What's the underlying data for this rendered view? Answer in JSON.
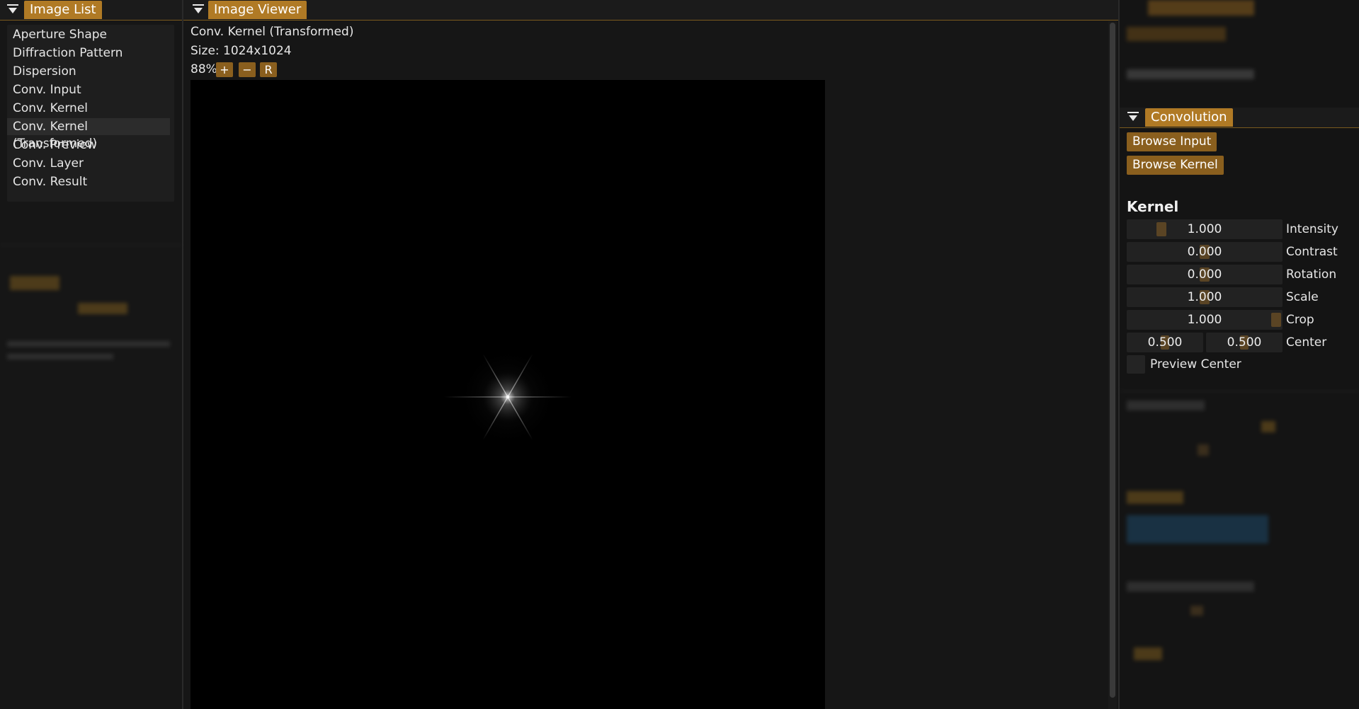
{
  "image_list": {
    "tab_label": "Image List",
    "items": [
      {
        "label": "Aperture Shape",
        "selected": false
      },
      {
        "label": "Diffraction Pattern",
        "selected": false
      },
      {
        "label": "Dispersion",
        "selected": false
      },
      {
        "label": "Conv. Input",
        "selected": false
      },
      {
        "label": "Conv. Kernel",
        "selected": false
      },
      {
        "label": "Conv. Kernel (Transformed)",
        "selected": true
      },
      {
        "label": "Conv. Preview",
        "selected": false
      },
      {
        "label": "Conv. Layer",
        "selected": false
      },
      {
        "label": "Conv. Result",
        "selected": false
      }
    ]
  },
  "image_viewer": {
    "tab_label": "Image Viewer",
    "image_name": "Conv. Kernel (Transformed)",
    "size_text": "Size: 1024x1024",
    "zoom_level": "88%",
    "zoom_in_label": "+",
    "zoom_out_label": "−",
    "reset_label": "R"
  },
  "convolution": {
    "tab_label": "Convolution",
    "browse_input_label": "Browse Input",
    "browse_kernel_label": "Browse Kernel",
    "kernel_section_title": "Kernel",
    "sliders": [
      {
        "label": "Intensity",
        "value": "1.000",
        "fraction": 0.2
      },
      {
        "label": "Contrast",
        "value": "0.000",
        "fraction": 0.5
      },
      {
        "label": "Rotation",
        "value": "0.000",
        "fraction": 0.5
      },
      {
        "label": "Scale",
        "value": "1.000",
        "fraction": 0.5
      },
      {
        "label": "Crop",
        "value": "1.000",
        "fraction": 1.0
      }
    ],
    "center": {
      "label": "Center",
      "x": "0.500",
      "y": "0.500"
    },
    "preview_center_label": "Preview Center"
  },
  "colors": {
    "accent": "#b07a25",
    "button": "#8a5f1e",
    "background": "#161616"
  }
}
